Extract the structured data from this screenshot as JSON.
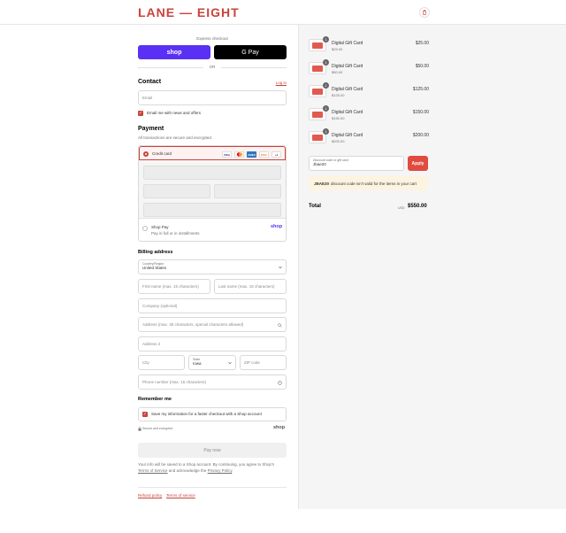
{
  "header": {
    "logo": "LANE — EIGHT",
    "cart_icon": "shopping-bag-icon"
  },
  "express": {
    "label": "Express checkout",
    "shop_button": "shop",
    "gpay_button": "G Pay",
    "or": "OR"
  },
  "contact": {
    "title": "Contact",
    "login_link": "Log in",
    "email_placeholder": "Email",
    "newsletter_label": "Email me with news and offers"
  },
  "payment": {
    "title": "Payment",
    "subtitle": "All transactions are secure and encrypted.",
    "credit_card_label": "Credit card",
    "card_brands": [
      "VISA",
      "MC",
      "AMEX",
      "DISC",
      "+4"
    ],
    "shop_pay_label": "Shop Pay",
    "shop_pay_sub": "Pay in full or in installments",
    "shop_pay_logo": "shop"
  },
  "billing": {
    "title": "Billing address",
    "country_label": "Country/Region",
    "country_value": "United States",
    "first_name": "First name (max. 15 characters)",
    "last_name": "Last name (max. 15 characters)",
    "company": "Company (optional)",
    "address": "Address (max. 35 characters, special characters allowed)",
    "address2": "Address 2",
    "city": "City",
    "state_label": "State",
    "state_value": "Iowa",
    "zip": "ZIP code",
    "phone": "Phone number (max. 15 characters)"
  },
  "remember": {
    "title": "Remember me",
    "save_label": "Save my information for a faster checkout with a Shop account",
    "secure_label": "Secure and encrypted",
    "shop_logo": "shop"
  },
  "pay_now": "Pay now",
  "legal": {
    "line1": "Your info will be saved to a Shop account. By continuing, you agree to Shop's",
    "terms_link": "Terms of Service",
    "middle": "and acknowledge the",
    "privacy_link": "Privacy Policy",
    "end": "."
  },
  "footer": {
    "refund": "Refund policy",
    "terms": "Terms of service"
  },
  "cart": {
    "items": [
      {
        "qty": "1",
        "name": "Digital Gift Card",
        "variant": "$25.00",
        "price": "$25.00"
      },
      {
        "qty": "1",
        "name": "Digital Gift Card",
        "variant": "$50.00",
        "price": "$50.00"
      },
      {
        "qty": "1",
        "name": "Digital Gift Card",
        "variant": "$125.00",
        "price": "$125.00"
      },
      {
        "qty": "1",
        "name": "Digital Gift Card",
        "variant": "$150.00",
        "price": "$150.00"
      },
      {
        "qty": "1",
        "name": "Digital Gift Card",
        "variant": "$200.00",
        "price": "$200.00"
      }
    ],
    "discount_label": "Discount code or gift card",
    "discount_value": "Jbae20",
    "apply": "Apply",
    "notice_code": "JBAE20",
    "notice_text": "discount code isn't valid for the items in your cart",
    "total_label": "Total",
    "currency": "USD",
    "total": "$550.00"
  },
  "colors": {
    "brand": "#c9433b",
    "shop_purple": "#5a31f4",
    "apply": "#e04a3f",
    "notice_bg": "#fdf3e1"
  }
}
